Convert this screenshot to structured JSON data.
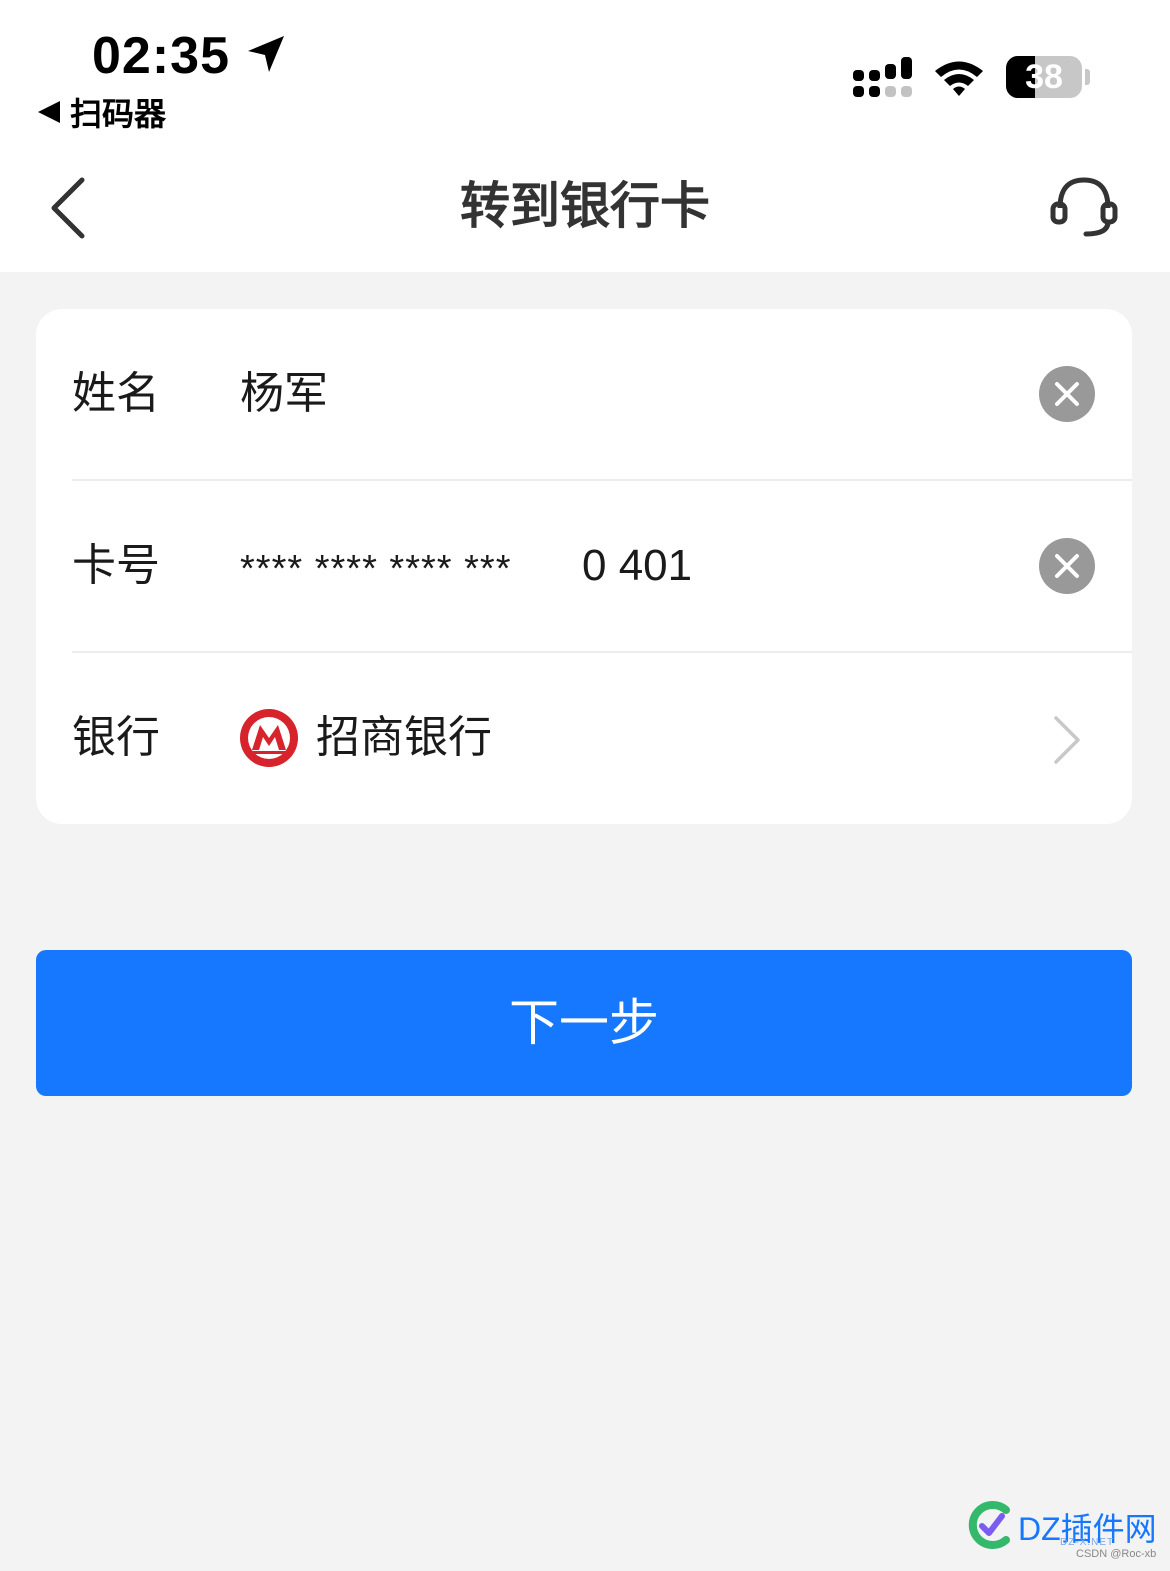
{
  "status_bar": {
    "time": "02:35",
    "back_app_label": "扫码器",
    "battery_level": "38",
    "battery_percent": 38,
    "signal_bars_filled": 2,
    "signal_bars_total": 4
  },
  "nav": {
    "title": "转到银行卡",
    "back_icon": "chevron-left-icon",
    "support_icon": "headset-icon"
  },
  "form": {
    "name": {
      "label": "姓名",
      "value": "杨军"
    },
    "card_number": {
      "label": "卡号",
      "masked": "**** **** **** ***",
      "digits": "0 401"
    },
    "bank": {
      "label": "银行",
      "value": "招商银行",
      "logo": "cmb-logo"
    }
  },
  "next_button": {
    "label": "下一步"
  },
  "watermark": {
    "text": "DZ插件网",
    "sub": "DZ-X.NET",
    "credit": "CSDN @Roc-xb"
  },
  "colors": {
    "accent": "#1677ff",
    "background": "#f3f3f3",
    "bank_logo_red": "#d6232c",
    "clear_button": "#999999"
  }
}
